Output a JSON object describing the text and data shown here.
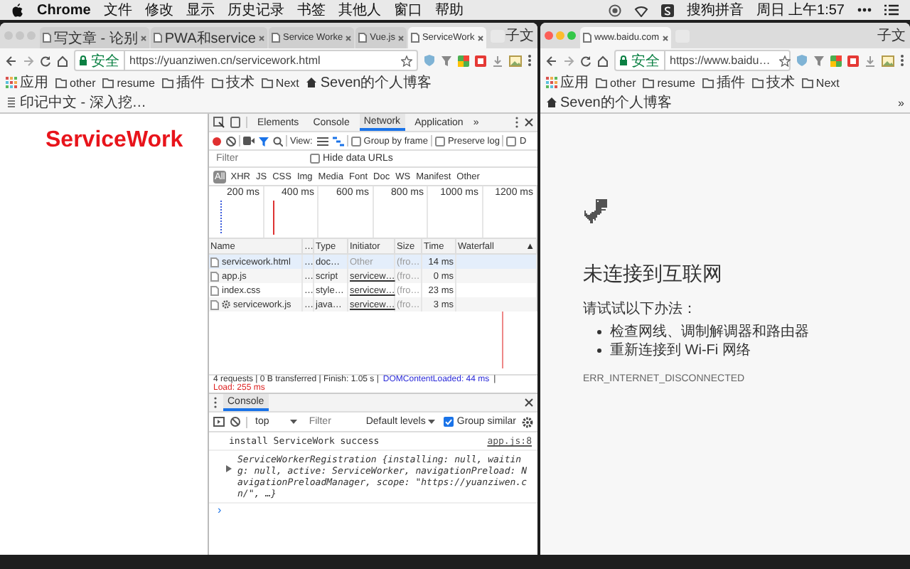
{
  "menu_bar": {
    "app": "Chrome",
    "items": [
      "文件",
      "修改",
      "显示",
      "历史记录",
      "书签",
      "其他人",
      "窗口",
      "帮助"
    ],
    "input_method": "搜狗拼音",
    "clock": "周日 上午1:57"
  },
  "left_window": {
    "focused": false,
    "profile": "子文",
    "tabs": [
      {
        "title": "写文章 - 论别",
        "selected": false
      },
      {
        "title": "PWA和service",
        "selected": false
      },
      {
        "title": "Service Worke",
        "selected": false
      },
      {
        "title": "Vue.js",
        "selected": false
      },
      {
        "title": "ServiceWork",
        "selected": true
      }
    ],
    "address": {
      "security": "安全",
      "url": "https://yuanziwen.cn/servicework.html"
    },
    "bookmarks": [
      {
        "label": "应用",
        "kind": "apps"
      },
      {
        "label": "other",
        "kind": "folder"
      },
      {
        "label": "resume",
        "kind": "folder"
      },
      {
        "label": "插件",
        "kind": "folder"
      },
      {
        "label": "技术",
        "kind": "folder"
      },
      {
        "label": "Next",
        "kind": "folder"
      },
      {
        "label": "Seven的个人博客",
        "kind": "site"
      },
      {
        "label": "印记中文 - 深入挖…",
        "kind": "page"
      }
    ]
  },
  "page": {
    "heading": "ServiceWork"
  },
  "devtools": {
    "tabs": [
      {
        "label": "Elements",
        "selected": false
      },
      {
        "label": "Console",
        "selected": false
      },
      {
        "label": "Network",
        "selected": true
      },
      {
        "label": "Application",
        "selected": false
      }
    ],
    "more": "»",
    "network": {
      "recording": true,
      "view_label": "View:",
      "options": [
        {
          "label": "Group by frame",
          "checked": false
        },
        {
          "label": "Preserve log",
          "checked": false
        },
        {
          "label": "D",
          "checked": false
        }
      ],
      "filter": {
        "placeholder": "Filter"
      },
      "hide_data_urls": {
        "label": "Hide data URLs",
        "checked": false
      },
      "types": [
        {
          "label": "All",
          "selected": true
        },
        {
          "label": "XHR",
          "selected": false
        },
        {
          "label": "JS",
          "selected": false
        },
        {
          "label": "CSS",
          "selected": false
        },
        {
          "label": "Img",
          "selected": false
        },
        {
          "label": "Media",
          "selected": false
        },
        {
          "label": "Font",
          "selected": false
        },
        {
          "label": "Doc",
          "selected": false
        },
        {
          "label": "WS",
          "selected": false
        },
        {
          "label": "Manifest",
          "selected": false
        },
        {
          "label": "Other",
          "selected": false
        }
      ],
      "overview_ticks": [
        "200 ms",
        "400 ms",
        "600 ms",
        "800 ms",
        "1000 ms",
        "1200 ms"
      ],
      "columns": [
        "Name",
        "…",
        "Type",
        "Initiator",
        "Size",
        "Time",
        "Waterfall"
      ],
      "sort_indicator": "▲",
      "rows": [
        {
          "name": "servicework.html",
          "column_2": "…",
          "type": "doc…",
          "initiator": "Other",
          "initiator_link": false,
          "size": "(fro…",
          "time": "14 ms",
          "selected": true,
          "kind": "file"
        },
        {
          "name": "app.js",
          "column_2": "…",
          "type": "script",
          "initiator": "servicew…",
          "initiator_link": true,
          "size": "(fro…",
          "time": "0 ms",
          "selected": false,
          "kind": "file"
        },
        {
          "name": "index.css",
          "column_2": "…",
          "type": "style…",
          "initiator": "servicew…",
          "initiator_link": true,
          "size": "(fro…",
          "time": "23 ms",
          "selected": false,
          "kind": "file"
        },
        {
          "name": "servicework.js",
          "column_2": "…",
          "type": "java…",
          "initiator": "servicew…",
          "initiator_link": true,
          "size": "(fro…",
          "time": "3 ms",
          "selected": false,
          "kind": "service_worker"
        }
      ],
      "status": {
        "summary": "4 requests | 0 B transferred | Finish: 1.05 s |",
        "dom_content_loaded": "DOMContentLoaded: 44 ms",
        "separator": "|",
        "load": "Load: 255 ms"
      }
    },
    "drawer": {
      "tabs": [
        {
          "label": "Console",
          "selected": true
        }
      ],
      "context": "top",
      "filter": {
        "placeholder": "Filter"
      },
      "levels": "Default levels",
      "group_similar": {
        "label": "Group similar",
        "checked": true
      },
      "messages": [
        {
          "kind": "log",
          "text": "install ServiceWork success",
          "source": "app.js:8"
        },
        {
          "kind": "object",
          "text": "ServiceWorkerRegistration {installing: null, waiting: null, active: ServiceWorker, navigationPreload: NavigationPreloadManager, scope: \"https://yuanziwen.cn/\", …}"
        }
      ],
      "prompt": "›"
    }
  },
  "right_window": {
    "focused": true,
    "profile": "子文",
    "tabs": [
      {
        "title": "www.baidu.com",
        "selected": true
      }
    ],
    "address": {
      "security": "安全",
      "url": "https://www.baidu…"
    },
    "bookmarks": [
      {
        "label": "应用",
        "kind": "apps"
      },
      {
        "label": "other",
        "kind": "folder"
      },
      {
        "label": "resume",
        "kind": "folder"
      },
      {
        "label": "插件",
        "kind": "folder"
      },
      {
        "label": "技术",
        "kind": "folder"
      },
      {
        "label": "Next",
        "kind": "folder"
      },
      {
        "label": "Seven的个人博客",
        "kind": "site"
      }
    ],
    "bookmarks_overflow": "»"
  },
  "error_page": {
    "title": "未连接到互联网",
    "intro": "请试试以下办法：",
    "suggestions": [
      "检查网线、调制解调器和路由器",
      "重新连接到 Wi-Fi 网络"
    ],
    "code": "ERR_INTERNET_DISCONNECTED"
  }
}
